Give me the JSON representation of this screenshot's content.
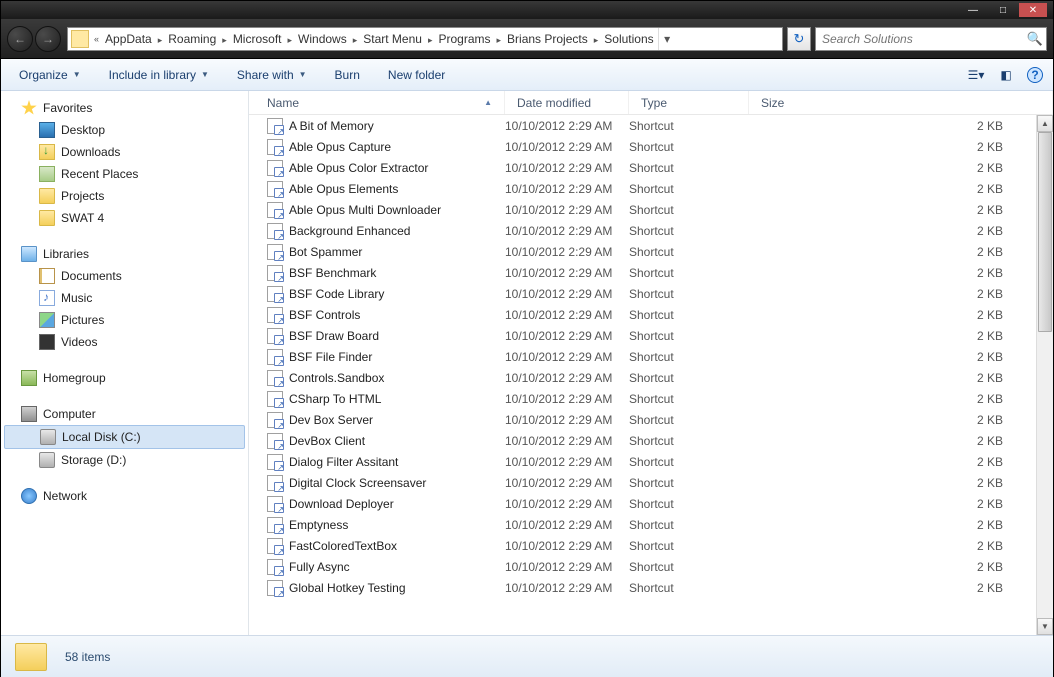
{
  "titlebar": {
    "min": "—",
    "max": "□",
    "close": "✕"
  },
  "nav": {
    "back": "←",
    "fwd": "→"
  },
  "breadcrumb": {
    "prefix": "«",
    "items": [
      "AppData",
      "Roaming",
      "Microsoft",
      "Windows",
      "Start Menu",
      "Programs",
      "Brians Projects",
      "Solutions"
    ]
  },
  "search": {
    "placeholder": "Search Solutions"
  },
  "toolbar": {
    "organize": "Organize",
    "include": "Include in library",
    "share": "Share with",
    "burn": "Burn",
    "newfolder": "New folder"
  },
  "sidebar": {
    "favorites": "Favorites",
    "fav_items": [
      "Desktop",
      "Downloads",
      "Recent Places",
      "Projects",
      "SWAT 4"
    ],
    "libraries": "Libraries",
    "lib_items": [
      "Documents",
      "Music",
      "Pictures",
      "Videos"
    ],
    "homegroup": "Homegroup",
    "computer": "Computer",
    "comp_items": [
      "Local Disk (C:)",
      "Storage (D:)"
    ],
    "network": "Network"
  },
  "columns": {
    "name": "Name",
    "date": "Date modified",
    "type": "Type",
    "size": "Size"
  },
  "files": [
    {
      "n": "A Bit of Memory",
      "d": "10/10/2012 2:29 AM",
      "t": "Shortcut",
      "s": "2 KB"
    },
    {
      "n": "Able Opus Capture",
      "d": "10/10/2012 2:29 AM",
      "t": "Shortcut",
      "s": "2 KB"
    },
    {
      "n": "Able Opus Color Extractor",
      "d": "10/10/2012 2:29 AM",
      "t": "Shortcut",
      "s": "2 KB"
    },
    {
      "n": "Able Opus Elements",
      "d": "10/10/2012 2:29 AM",
      "t": "Shortcut",
      "s": "2 KB"
    },
    {
      "n": "Able Opus Multi Downloader",
      "d": "10/10/2012 2:29 AM",
      "t": "Shortcut",
      "s": "2 KB"
    },
    {
      "n": "Background Enhanced",
      "d": "10/10/2012 2:29 AM",
      "t": "Shortcut",
      "s": "2 KB"
    },
    {
      "n": "Bot Spammer",
      "d": "10/10/2012 2:29 AM",
      "t": "Shortcut",
      "s": "2 KB"
    },
    {
      "n": "BSF Benchmark",
      "d": "10/10/2012 2:29 AM",
      "t": "Shortcut",
      "s": "2 KB"
    },
    {
      "n": "BSF Code Library",
      "d": "10/10/2012 2:29 AM",
      "t": "Shortcut",
      "s": "2 KB"
    },
    {
      "n": "BSF Controls",
      "d": "10/10/2012 2:29 AM",
      "t": "Shortcut",
      "s": "2 KB"
    },
    {
      "n": "BSF Draw Board",
      "d": "10/10/2012 2:29 AM",
      "t": "Shortcut",
      "s": "2 KB"
    },
    {
      "n": "BSF File Finder",
      "d": "10/10/2012 2:29 AM",
      "t": "Shortcut",
      "s": "2 KB"
    },
    {
      "n": "Controls.Sandbox",
      "d": "10/10/2012 2:29 AM",
      "t": "Shortcut",
      "s": "2 KB"
    },
    {
      "n": "CSharp To HTML",
      "d": "10/10/2012 2:29 AM",
      "t": "Shortcut",
      "s": "2 KB"
    },
    {
      "n": "Dev Box Server",
      "d": "10/10/2012 2:29 AM",
      "t": "Shortcut",
      "s": "2 KB"
    },
    {
      "n": "DevBox Client",
      "d": "10/10/2012 2:29 AM",
      "t": "Shortcut",
      "s": "2 KB"
    },
    {
      "n": "Dialog Filter Assitant",
      "d": "10/10/2012 2:29 AM",
      "t": "Shortcut",
      "s": "2 KB"
    },
    {
      "n": "Digital Clock Screensaver",
      "d": "10/10/2012 2:29 AM",
      "t": "Shortcut",
      "s": "2 KB"
    },
    {
      "n": "Download Deployer",
      "d": "10/10/2012 2:29 AM",
      "t": "Shortcut",
      "s": "2 KB"
    },
    {
      "n": "Emptyness",
      "d": "10/10/2012 2:29 AM",
      "t": "Shortcut",
      "s": "2 KB"
    },
    {
      "n": "FastColoredTextBox",
      "d": "10/10/2012 2:29 AM",
      "t": "Shortcut",
      "s": "2 KB"
    },
    {
      "n": "Fully Async",
      "d": "10/10/2012 2:29 AM",
      "t": "Shortcut",
      "s": "2 KB"
    },
    {
      "n": "Global Hotkey Testing",
      "d": "10/10/2012 2:29 AM",
      "t": "Shortcut",
      "s": "2 KB"
    }
  ],
  "status": {
    "text": "58 items"
  }
}
